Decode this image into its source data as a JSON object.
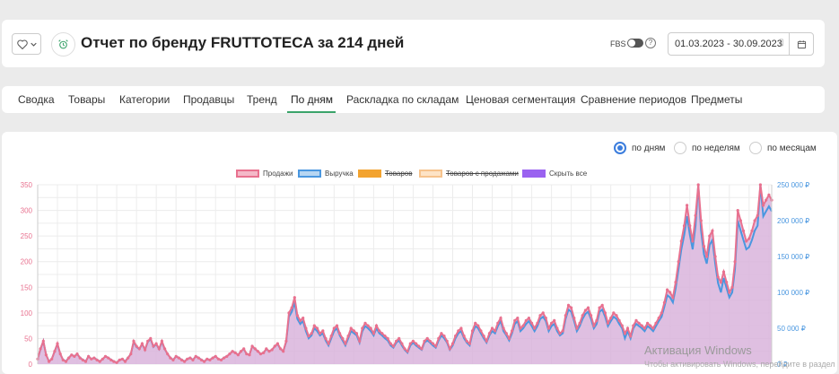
{
  "header": {
    "title": "Отчет по бренду FRUTTOTECA за 214 дней",
    "fbs_label": "FBS",
    "fbs_enabled": false,
    "date_range": "01.03.2023 - 30.09.2023"
  },
  "tabs": [
    {
      "label": "Сводка",
      "active": false
    },
    {
      "label": "Товары",
      "active": false
    },
    {
      "label": "Категории",
      "active": false
    },
    {
      "label": "Продавцы",
      "active": false
    },
    {
      "label": "Тренд",
      "active": false
    },
    {
      "label": "По дням",
      "active": true
    },
    {
      "label": "Раскладка по складам",
      "active": false
    },
    {
      "label": "Ценовая сегментация",
      "active": false
    },
    {
      "label": "Сравнение периодов",
      "active": false
    },
    {
      "label": "Предметы",
      "active": false
    }
  ],
  "period_options": [
    {
      "label": "по дням",
      "selected": true
    },
    {
      "label": "по неделям",
      "selected": false
    },
    {
      "label": "по месяцам",
      "selected": false
    }
  ],
  "colors": {
    "sales": "#e8718f",
    "revenue": "#4a97e0",
    "products": "#f3a32f",
    "products_sold": "#f6c38d",
    "hide_all": "#9a62f0",
    "fill": "#d9b4dc",
    "accent": "#3aa36a"
  },
  "watermark": {
    "title": "Активация Windows",
    "subtitle": "Чтобы активировать Windows, перейдите в раздел"
  },
  "chart_data": {
    "type": "line",
    "legend": [
      {
        "name": "Продажи",
        "hidden": false
      },
      {
        "name": "Выручка",
        "hidden": false
      },
      {
        "name": "Товаров",
        "hidden": true
      },
      {
        "name": "Товаров с продажами",
        "hidden": true
      },
      {
        "name": "Скрыть все",
        "hidden": false
      }
    ],
    "y_left": {
      "min": 0,
      "max": 350,
      "ticks": [
        "350",
        "300",
        "250",
        "200",
        "150",
        "100",
        "50",
        "0"
      ]
    },
    "y_right": {
      "min": 0,
      "max": 250000,
      "ticks": [
        "250 000 ₽",
        "200 000 ₽",
        "150 000 ₽",
        "100 000 ₽",
        "50 000 ₽",
        "0 ₽"
      ]
    },
    "series": [
      {
        "name": "Продажи",
        "values": [
          10,
          30,
          45,
          18,
          5,
          10,
          25,
          40,
          20,
          8,
          5,
          12,
          18,
          15,
          20,
          12,
          8,
          5,
          15,
          10,
          12,
          8,
          5,
          10,
          15,
          12,
          8,
          5,
          3,
          8,
          10,
          5,
          12,
          20,
          45,
          35,
          30,
          40,
          28,
          45,
          50,
          35,
          40,
          30,
          45,
          30,
          20,
          12,
          8,
          15,
          12,
          8,
          5,
          10,
          12,
          8,
          15,
          12,
          8,
          5,
          10,
          8,
          12,
          15,
          10,
          8,
          12,
          15,
          20,
          25,
          22,
          18,
          25,
          30,
          20,
          18,
          35,
          30,
          25,
          20,
          22,
          30,
          25,
          28,
          35,
          40,
          30,
          25,
          45,
          100,
          110,
          130,
          95,
          85,
          90,
          70,
          55,
          60,
          75,
          70,
          60,
          65,
          50,
          40,
          55,
          70,
          75,
          60,
          50,
          40,
          55,
          70,
          65,
          60,
          45,
          70,
          80,
          75,
          70,
          60,
          75,
          65,
          60,
          55,
          50,
          40,
          35,
          45,
          50,
          40,
          30,
          25,
          40,
          45,
          40,
          35,
          30,
          45,
          50,
          45,
          40,
          35,
          50,
          60,
          55,
          45,
          30,
          40,
          55,
          65,
          70,
          55,
          45,
          40,
          65,
          80,
          75,
          65,
          55,
          45,
          60,
          70,
          65,
          80,
          90,
          70,
          60,
          50,
          65,
          85,
          90,
          70,
          75,
          85,
          90,
          80,
          70,
          80,
          95,
          100,
          90,
          70,
          80,
          85,
          70,
          60,
          65,
          95,
          115,
          110,
          90,
          70,
          80,
          95,
          105,
          110,
          95,
          75,
          85,
          110,
          115,
          100,
          80,
          90,
          100,
          95,
          85,
          75,
          60,
          70,
          55,
          75,
          85,
          80,
          75,
          70,
          80,
          75,
          70,
          80,
          90,
          100,
          120,
          145,
          140,
          130,
          160,
          200,
          240,
          270,
          310,
          270,
          240,
          290,
          350,
          280,
          230,
          210,
          250,
          260,
          210,
          170,
          160,
          180,
          160,
          140,
          150,
          200,
          300,
          280,
          260,
          240,
          245,
          260,
          280,
          290,
          350,
          310,
          320,
          330,
          320
        ]
      },
      {
        "name": "Выручка",
        "values": [
          7000,
          21000,
          32000,
          13000,
          4000,
          7000,
          18000,
          28000,
          14000,
          6000,
          4000,
          9000,
          13000,
          11000,
          14000,
          9000,
          6000,
          4000,
          11000,
          7000,
          9000,
          6000,
          4000,
          7000,
          11000,
          9000,
          6000,
          4000,
          2000,
          6000,
          7000,
          4000,
          9000,
          14000,
          31000,
          24000,
          21000,
          28000,
          20000,
          31000,
          35000,
          24000,
          28000,
          21000,
          31000,
          21000,
          14000,
          9000,
          6000,
          11000,
          9000,
          6000,
          4000,
          7000,
          9000,
          6000,
          11000,
          9000,
          6000,
          4000,
          7000,
          6000,
          9000,
          11000,
          7000,
          6000,
          9000,
          11000,
          14000,
          18000,
          16000,
          13000,
          18000,
          21000,
          14000,
          13000,
          25000,
          21000,
          18000,
          14000,
          16000,
          21000,
          18000,
          20000,
          25000,
          28000,
          21000,
          18000,
          31000,
          66000,
          73000,
          86000,
          63000,
          56000,
          60000,
          46000,
          36000,
          40000,
          50000,
          46000,
          40000,
          43000,
          33000,
          26000,
          36000,
          46000,
          50000,
          40000,
          33000,
          26000,
          36000,
          46000,
          43000,
          40000,
          30000,
          46000,
          53000,
          50000,
          46000,
          40000,
          50000,
          43000,
          40000,
          36000,
          33000,
          26000,
          23000,
          30000,
          33000,
          26000,
          20000,
          16000,
          26000,
          30000,
          26000,
          23000,
          20000,
          30000,
          33000,
          30000,
          26000,
          23000,
          33000,
          40000,
          36000,
          30000,
          20000,
          26000,
          36000,
          43000,
          46000,
          36000,
          30000,
          26000,
          43000,
          53000,
          50000,
          43000,
          36000,
          30000,
          40000,
          46000,
          43000,
          53000,
          60000,
          46000,
          40000,
          33000,
          43000,
          56000,
          60000,
          46000,
          50000,
          56000,
          60000,
          53000,
          46000,
          53000,
          63000,
          66000,
          60000,
          46000,
          53000,
          56000,
          46000,
          40000,
          43000,
          63000,
          76000,
          73000,
          60000,
          46000,
          53000,
          63000,
          70000,
          73000,
          63000,
          50000,
          56000,
          73000,
          76000,
          66000,
          53000,
          60000,
          66000,
          63000,
          56000,
          50000,
          36000,
          46000,
          36000,
          50000,
          56000,
          53000,
          50000,
          46000,
          53000,
          50000,
          46000,
          53000,
          60000,
          66000,
          80000,
          96000,
          93000,
          86000,
          106000,
          133000,
          160000,
          180000,
          206000,
          180000,
          160000,
          193000,
          250000,
          186000,
          153000,
          140000,
          166000,
          173000,
          140000,
          113000,
          100000,
          120000,
          106000,
          93000,
          100000,
          133000,
          200000,
          186000,
          173000,
          160000,
          163000,
          173000,
          186000,
          193000,
          250000,
          206000,
          213000,
          220000,
          213000
        ]
      }
    ]
  }
}
